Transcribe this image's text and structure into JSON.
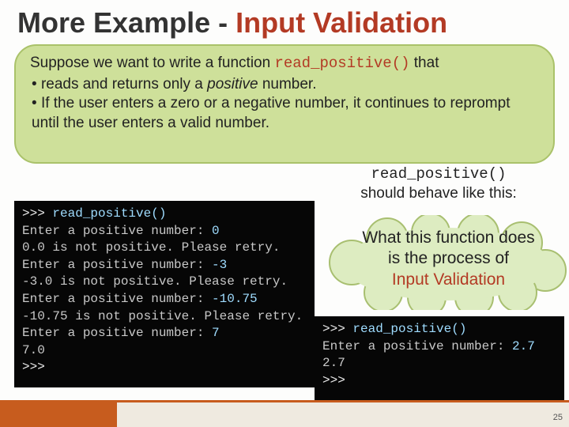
{
  "title": {
    "prefix": "More Example - ",
    "accent": "Input Validation"
  },
  "intro": {
    "line1_a": "Suppose we want to write a function ",
    "line1_code": "read_positive()",
    "line1_b": " that",
    "bullet1_a": "reads and returns only a ",
    "bullet1_em": "positive",
    "bullet1_b": " number.",
    "bullet2": "If the user enters a zero or a negative number, it continues to reprompt until the user enters a valid number."
  },
  "note": {
    "code": "read_positive()",
    "text": "should behave like this:"
  },
  "bubble": {
    "line1": "What this function does",
    "line2": "is the process of",
    "accent": "Input Validation"
  },
  "terminal_left": {
    "l0_p": ">>> ",
    "l0_i": "read_positive()",
    "l1_o": "Enter a positive number: ",
    "l1_i": "0",
    "l2_o": "0.0 is not positive. Please retry.",
    "l3_o": "Enter a positive number: ",
    "l3_i": "-3",
    "l4_o": "-3.0 is not positive. Please retry.",
    "l5_o": "Enter a positive number: ",
    "l5_i": "-10.75",
    "l6_o": "-10.75 is not positive. Please retry.",
    "l7_o": "Enter a positive number: ",
    "l7_i": "7",
    "l8_o": "7.0",
    "l9_p": ">>> "
  },
  "terminal_right": {
    "l0_p": ">>> ",
    "l0_i": "read_positive()",
    "l1_o": "Enter a positive number: ",
    "l1_i": "2.7",
    "l2_o": "2.7",
    "l3_p": ">>> "
  },
  "page_number": "25"
}
